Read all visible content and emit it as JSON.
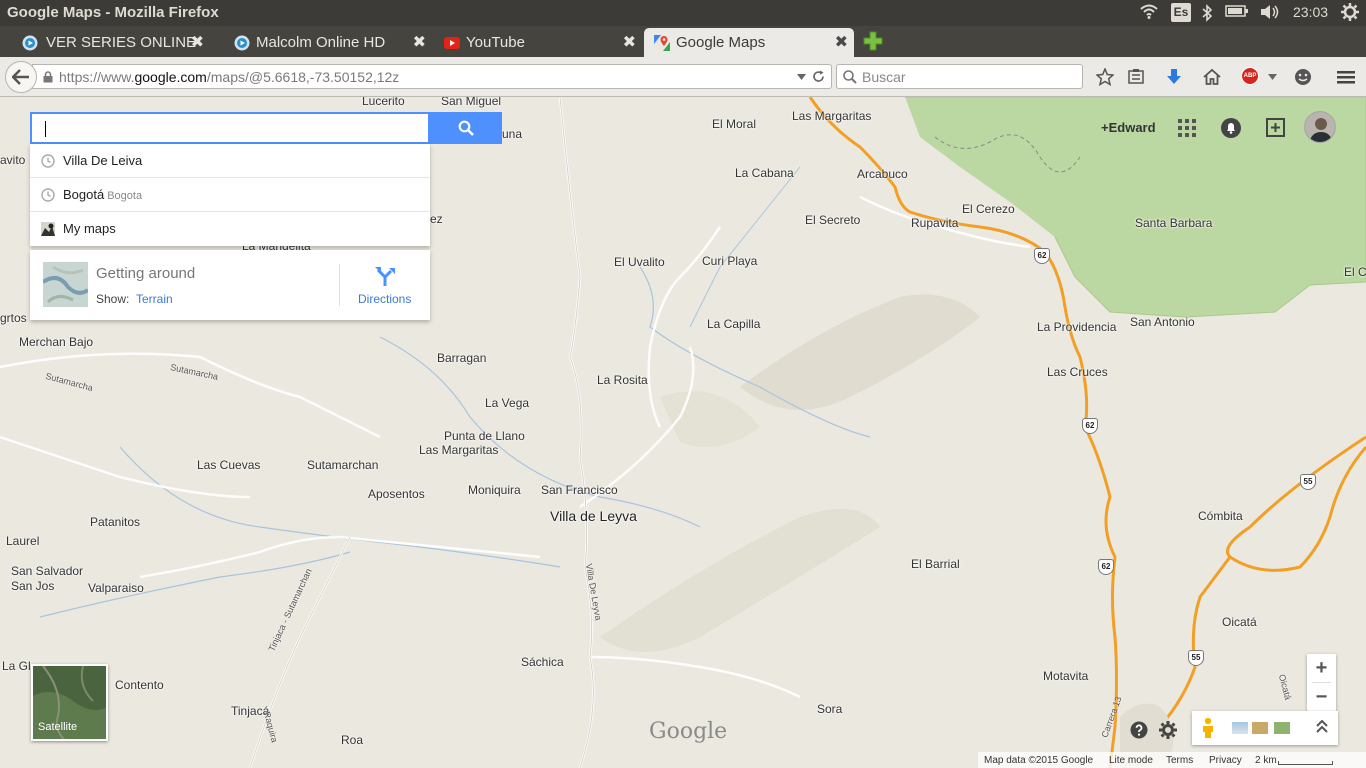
{
  "os": {
    "window_title": "Google Maps - Mozilla Firefox",
    "lang": "Es",
    "time": "23:03"
  },
  "tabs": [
    {
      "title": "VER SERIES ONLINE ...",
      "icon": "tv-circle-icon",
      "active": false
    },
    {
      "title": "Malcolm Online HD",
      "icon": "tv-circle-icon",
      "active": false
    },
    {
      "title": "YouTube",
      "icon": "youtube-icon",
      "active": false
    },
    {
      "title": "Google Maps",
      "icon": "google-maps-icon",
      "active": true
    }
  ],
  "tab_close_glyph": "✖",
  "navbar": {
    "url_prefix": "https://www.",
    "url_domain": "google.com",
    "url_rest": "/maps/@5.6618,-73.50152,12z",
    "search_placeholder": "Buscar",
    "addon_badge": "ABP"
  },
  "maps": {
    "search_query": "",
    "suggestions": [
      {
        "main": "Villa De Leiva",
        "sub": "",
        "icon": "history-clock-icon"
      },
      {
        "main": "Bogotá",
        "sub": "Bogota",
        "icon": "history-clock-icon"
      },
      {
        "main": "My maps",
        "sub": "",
        "icon": "my-maps-icon"
      }
    ],
    "getting_around": {
      "title": "Getting around",
      "show_label": "Show:",
      "show_link": "Terrain",
      "directions_label": "Directions"
    },
    "account": {
      "name": "+Edward"
    },
    "satellite_label": "Satellite",
    "logo": "Google",
    "zoom_in": "+",
    "zoom_out": "−",
    "footer": {
      "map_data": "Map data ©2015 Google",
      "lite_mode": "Lite mode",
      "terms": "Terms",
      "privacy": "Privacy",
      "scale": "2 km"
    }
  },
  "places": [
    {
      "name": "Lucerito",
      "big": false
    },
    {
      "name": "San Miguel",
      "big": false
    },
    {
      "name": "El Moral",
      "big": false
    },
    {
      "name": "Las Margaritas",
      "big": false
    },
    {
      "name": "La Cabana",
      "big": false
    },
    {
      "name": "Arcabuco",
      "big": false
    },
    {
      "name": "El Cerezo",
      "big": false
    },
    {
      "name": "Santa Barbara",
      "big": false
    },
    {
      "name": "El Secreto",
      "big": false
    },
    {
      "name": "Rupavita",
      "big": false
    },
    {
      "name": "El Uvalito",
      "big": false
    },
    {
      "name": "Curi Playa",
      "big": false
    },
    {
      "name": "La Capilla",
      "big": false
    },
    {
      "name": "La Providencia",
      "big": false
    },
    {
      "name": "San Antonio",
      "big": false
    },
    {
      "name": "Merchan Bajo",
      "big": false
    },
    {
      "name": "Barragan",
      "big": false
    },
    {
      "name": "La Rosita",
      "big": false
    },
    {
      "name": "Las Cruces",
      "big": false
    },
    {
      "name": "La Vega",
      "big": false
    },
    {
      "name": "Punta de Llano",
      "big": false
    },
    {
      "name": "Las Margaritas",
      "big": false
    },
    {
      "name": "Las Cuevas",
      "big": false
    },
    {
      "name": "Sutamarchan",
      "big": false
    },
    {
      "name": "Aposentos",
      "big": false
    },
    {
      "name": "Moniquira",
      "big": false
    },
    {
      "name": "San Francisco",
      "big": false
    },
    {
      "name": "Villa de Leyva",
      "big": true
    },
    {
      "name": "Patanitos",
      "big": false
    },
    {
      "name": "Cómbita",
      "big": false
    },
    {
      "name": "Laurel",
      "big": false
    },
    {
      "name": "San Salvador",
      "big": false
    },
    {
      "name": "San Jos",
      "big": false
    },
    {
      "name": "Valparaiso",
      "big": false
    },
    {
      "name": "El Barrial",
      "big": false
    },
    {
      "name": "Oicatá",
      "big": false
    },
    {
      "name": "La Gl",
      "big": false
    },
    {
      "name": "Sáchica",
      "big": false
    },
    {
      "name": "Contento",
      "big": false
    },
    {
      "name": "Motavita",
      "big": false
    },
    {
      "name": "Tinjacá",
      "big": false
    },
    {
      "name": "Sora",
      "big": false
    },
    {
      "name": "Roa",
      "big": false
    },
    {
      "name": "avito",
      "big": false
    },
    {
      "name": "grtos",
      "big": false
    },
    {
      "name": "El C",
      "big": false
    },
    {
      "name": "La Mandelita",
      "big": false
    },
    {
      "name": "una",
      "big": false
    },
    {
      "name": "ez",
      "big": false
    }
  ],
  "road_labels": [
    "Sutamarcha",
    "Sutamarcha",
    "Villa De Leyva",
    "Tinjaca - Sutamarchan",
    "Raquira",
    "Carrera 13",
    "Oicatá"
  ],
  "shields": [
    "62",
    "62",
    "62",
    "55",
    "55"
  ]
}
